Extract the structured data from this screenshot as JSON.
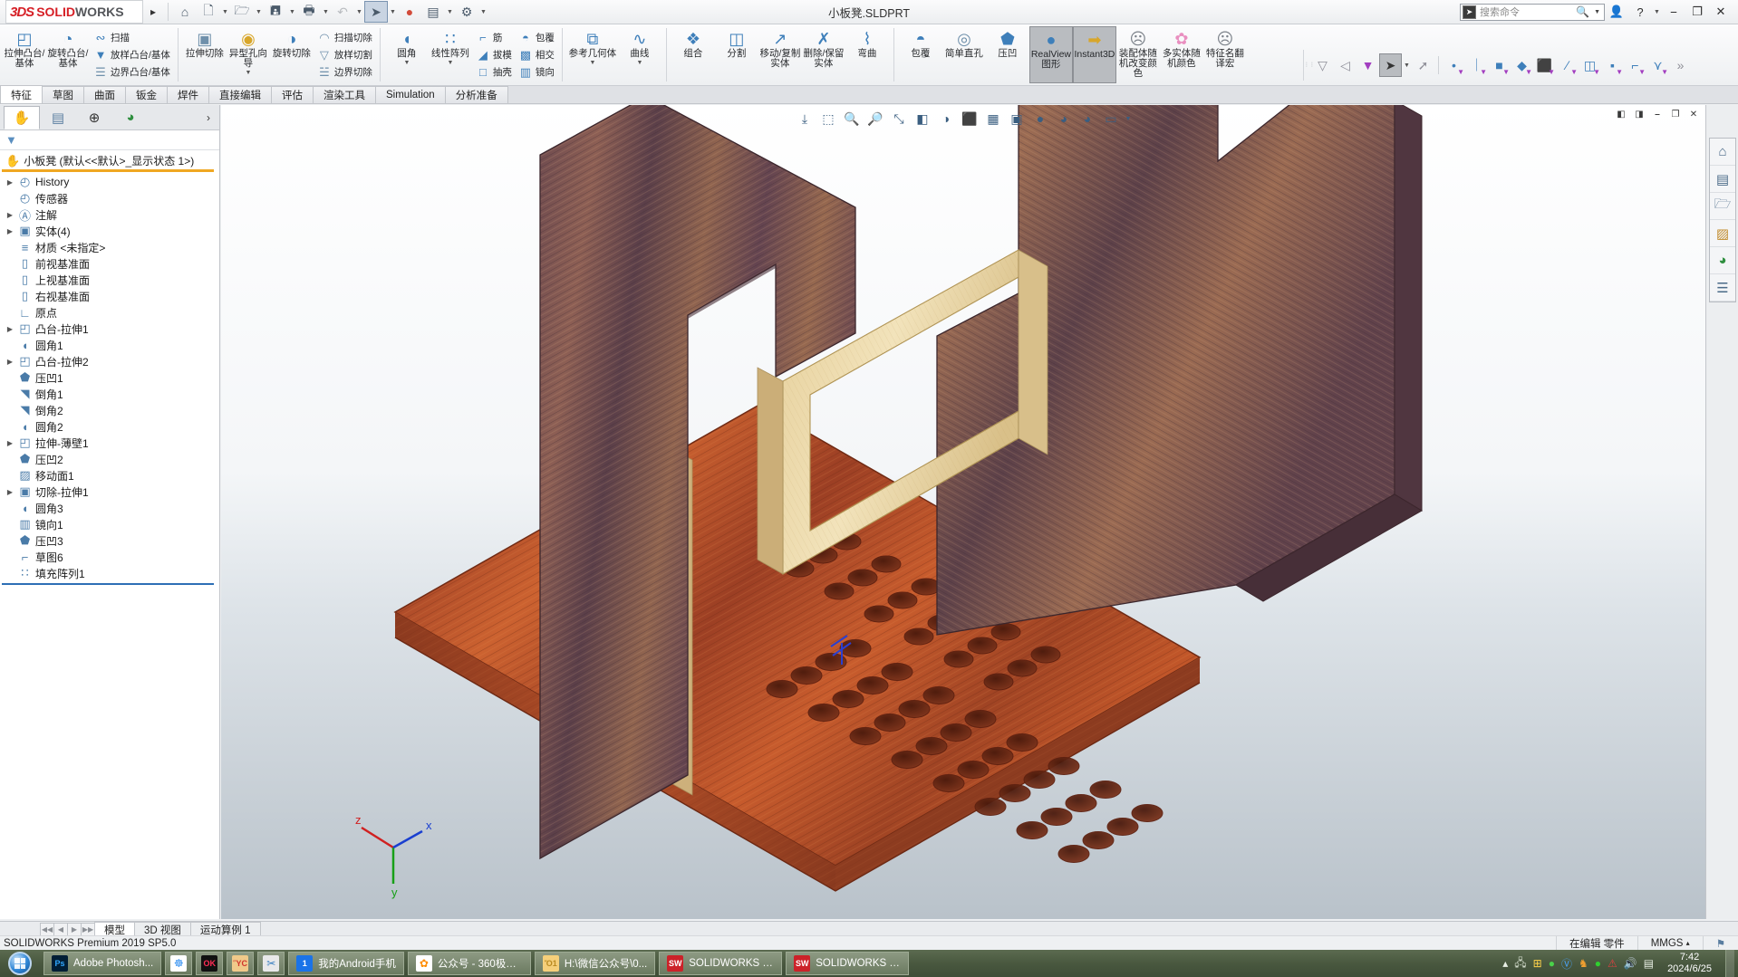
{
  "titlebar": {
    "logo_3ds": "3DS",
    "logo_solid": "SOLID",
    "logo_works": "WORKS",
    "document_title": "小板凳.SLDPRT",
    "quick_access": [
      {
        "name": "home-icon",
        "glyph": "⌂"
      },
      {
        "name": "new-doc-icon",
        "glyph": "὜B"
      },
      {
        "name": "open-icon",
        "glyph": "὜1"
      },
      {
        "name": "save-icon",
        "glyph": "ὋE"
      },
      {
        "name": "print-icon",
        "glyph": "Ὓ6"
      },
      {
        "name": "undo-icon",
        "glyph": "↶"
      },
      {
        "name": "select-icon",
        "glyph": "➤"
      },
      {
        "name": "rebuild-icon",
        "glyph": "⚠"
      },
      {
        "name": "display-icon",
        "glyph": "▤"
      },
      {
        "name": "options-icon",
        "glyph": "⚙"
      }
    ],
    "search_placeholder": "搜索命令",
    "window_buttons": [
      "—",
      "❐",
      "✕"
    ]
  },
  "ribbon": {
    "groups": [
      {
        "name": "boss-base-group",
        "big": [
          {
            "label": "拉伸凸台/基体",
            "icon": "extrude-boss-icon",
            "glyph": "◰",
            "color": "ic-blue",
            "caret": false
          },
          {
            "label": "旋转凸台/基体",
            "icon": "revolve-boss-icon",
            "glyph": "◔",
            "color": "ic-blue",
            "caret": false
          }
        ],
        "small": [
          {
            "label": "扫描",
            "icon": "sweep-icon",
            "glyph": "∴",
            "color": "ic-blue"
          },
          {
            "label": "放样凸台/基体",
            "icon": "loft-icon",
            "glyph": "▼",
            "color": "ic-blue"
          },
          {
            "label": "边界凸台/基体",
            "icon": "boundary-boss-icon",
            "glyph": "❐",
            "color": "ic-steel"
          }
        ]
      },
      {
        "name": "cut-group",
        "big": [
          {
            "label": "拉伸切除",
            "icon": "extrude-cut-icon",
            "glyph": "▣",
            "color": "ic-steel",
            "caret": false
          },
          {
            "label": "异型孔向导",
            "icon": "hole-wizard-icon",
            "glyph": "◉",
            "color": "ic-gold",
            "caret": true
          },
          {
            "label": "旋转切除",
            "icon": "revolve-cut-icon",
            "glyph": "◑",
            "color": "ic-blue",
            "caret": false
          }
        ],
        "small": [
          {
            "label": "扫描切除",
            "icon": "sweep-cut-icon",
            "glyph": "◠",
            "color": "ic-steel"
          },
          {
            "label": "放样切割",
            "icon": "loft-cut-icon",
            "glyph": "▽",
            "color": "ic-steel"
          },
          {
            "label": "边界切除",
            "icon": "boundary-cut-icon",
            "glyph": "❑",
            "color": "ic-steel"
          }
        ]
      },
      {
        "name": "feature-group",
        "big": [
          {
            "label": "圆角",
            "icon": "fillet-icon",
            "glyph": "◖",
            "color": "ic-blue",
            "caret": true
          },
          {
            "label": "线性阵列",
            "icon": "linear-pattern-icon",
            "glyph": "∷",
            "color": "ic-blue",
            "caret": true
          }
        ],
        "small": [
          {
            "label": "筋",
            "icon": "rib-icon",
            "glyph": "⌐",
            "color": "ic-blue"
          },
          {
            "label": "拔模",
            "icon": "draft-icon",
            "glyph": "◢",
            "color": "ic-blue"
          },
          {
            "label": "抽壳",
            "icon": "shell-icon",
            "glyph": "□",
            "color": "ic-blue"
          }
        ],
        "small2": [
          {
            "label": "包覆",
            "icon": "wrap-icon",
            "glyph": "◓",
            "color": "ic-blue"
          },
          {
            "label": "相交",
            "icon": "intersect-icon",
            "glyph": "▩",
            "color": "ic-blue"
          },
          {
            "label": "镜向",
            "icon": "mirror-icon",
            "glyph": "▥",
            "color": "ic-blue"
          }
        ]
      },
      {
        "name": "reference-group",
        "big": [
          {
            "label": "参考几何体",
            "icon": "reference-geometry-icon",
            "glyph": "⧉",
            "color": "ic-blue",
            "caret": true
          },
          {
            "label": "曲线",
            "icon": "curves-icon",
            "glyph": "∿",
            "color": "ic-blue",
            "caret": true
          }
        ],
        "small": []
      },
      {
        "name": "bodies-group",
        "big": [
          {
            "label": "组合",
            "icon": "combine-icon",
            "glyph": "❖",
            "color": "ic-blue",
            "caret": false
          },
          {
            "label": "分割",
            "icon": "split-icon",
            "glyph": "◫",
            "color": "ic-blue",
            "caret": false
          },
          {
            "label": "移动/复制实体",
            "icon": "move-copy-body-icon",
            "glyph": "↗",
            "color": "ic-blue",
            "caret": false
          },
          {
            "label": "删除/保留实体",
            "icon": "delete-keep-body-icon",
            "glyph": "✗",
            "color": "ic-blue",
            "caret": false
          },
          {
            "label": "弯曲",
            "icon": "flex-icon",
            "glyph": "⌇",
            "color": "ic-blue",
            "caret": false
          }
        ],
        "small": []
      },
      {
        "name": "misc-group",
        "big": [
          {
            "label": "包覆",
            "icon": "wrap2-icon",
            "glyph": "◓",
            "color": "ic-blue",
            "caret": false
          },
          {
            "label": "简单直孔",
            "icon": "simple-hole-icon",
            "glyph": "◎",
            "color": "ic-steel",
            "caret": false
          },
          {
            "label": "压凹",
            "icon": "indent-icon",
            "glyph": "⬟",
            "color": "ic-blue",
            "caret": false
          },
          {
            "label": "RealView 图形",
            "icon": "realview-icon",
            "glyph": "●",
            "color": "ic-blue",
            "caret": false,
            "active": true
          },
          {
            "label": "Instant3D",
            "icon": "instant3d-icon",
            "glyph": "➡",
            "color": "ic-gold",
            "caret": false,
            "active": true
          },
          {
            "label": "装配体随机改变颜色",
            "icon": "assembly-random-color-icon",
            "glyph": "⚹",
            "color": "ic-gray",
            "caret": false
          },
          {
            "label": "多实体随机颜色",
            "icon": "multibody-random-color-icon",
            "glyph": "✿",
            "color": "ic-pink",
            "caret": false
          },
          {
            "label": "特征名翻译宏",
            "icon": "feature-name-macro-icon",
            "glyph": "⚹",
            "color": "ic-gray",
            "caret": false
          }
        ],
        "small": []
      }
    ],
    "subbar": {
      "icons": [
        {
          "name": "filter-faces-icon",
          "glyph": "▽",
          "style": ""
        },
        {
          "name": "filter-edges-icon",
          "glyph": "◁",
          "style": ""
        },
        {
          "name": "filter-active-icon",
          "glyph": "▼",
          "style": "purple"
        },
        {
          "name": "select-arrow-icon",
          "glyph": "➤",
          "style": "sel"
        },
        {
          "name": "select-caret-icon",
          "glyph": "▾",
          "style": "caret"
        },
        {
          "name": "select-other-icon",
          "glyph": "➚",
          "style": ""
        },
        {
          "name": "sketch-point-icon",
          "glyph": "•",
          "style": "blue"
        },
        {
          "name": "sketch-line-icon",
          "glyph": "｜",
          "style": "blue"
        },
        {
          "name": "sketch-rectangle-icon",
          "glyph": "■",
          "style": "blue"
        },
        {
          "name": "sketch-slot-icon",
          "glyph": "◆",
          "style": "blue"
        },
        {
          "name": "sketch-3d-icon",
          "glyph": "⬛",
          "style": "blue"
        },
        {
          "name": "sketch-spline-icon",
          "glyph": "∕",
          "style": "blue"
        },
        {
          "name": "sketch-plane-icon",
          "glyph": "◫",
          "style": "blue"
        },
        {
          "name": "sketch-dim-icon",
          "glyph": "▪",
          "style": "blue"
        },
        {
          "name": "sketch-fillet-icon",
          "glyph": "⌐",
          "style": "blue"
        },
        {
          "name": "sketch-trim-icon",
          "glyph": "⋎",
          "style": "blue"
        },
        {
          "name": "overflow-chevron-icon",
          "glyph": "»",
          "style": ""
        }
      ]
    }
  },
  "command_tabs": [
    {
      "label": "特征",
      "active": true
    },
    {
      "label": "草图",
      "active": false
    },
    {
      "label": "曲面",
      "active": false
    },
    {
      "label": "钣金",
      "active": false
    },
    {
      "label": "焊件",
      "active": false
    },
    {
      "label": "直接编辑",
      "active": false
    },
    {
      "label": "评估",
      "active": false
    },
    {
      "label": "渲染工具",
      "active": false
    },
    {
      "label": "Simulation",
      "active": false
    },
    {
      "label": "分析准备",
      "active": false
    }
  ],
  "feature_manager": {
    "tabs": [
      {
        "name": "feature-tree-tab",
        "glyph": "✋",
        "color": "#e8b53a",
        "active": true
      },
      {
        "name": "property-manager-tab",
        "glyph": "▤",
        "color": "#5a7ea0",
        "active": false
      },
      {
        "name": "configuration-manager-tab",
        "glyph": "⊕",
        "color": "#3a3a3a",
        "active": false
      },
      {
        "name": "display-manager-tab",
        "glyph": "◕",
        "color": "#3a8a3a",
        "active": false
      }
    ],
    "expand_glyph": "›",
    "filter_placeholder": "",
    "root": "小板凳  (默认<<默认>_显示状态 1>)",
    "nodes": [
      {
        "label": "History",
        "glyph": "◴",
        "expandable": true
      },
      {
        "label": "传感器",
        "glyph": "◴",
        "expandable": false
      },
      {
        "label": "注解",
        "glyph": "Ⓐ",
        "expandable": true
      },
      {
        "label": "实体(4)",
        "glyph": "▣",
        "expandable": true
      },
      {
        "label": "材质 <未指定>",
        "glyph": "≡",
        "expandable": false
      },
      {
        "label": "前视基准面",
        "glyph": "▯",
        "expandable": false
      },
      {
        "label": "上视基准面",
        "glyph": "▯",
        "expandable": false
      },
      {
        "label": "右视基准面",
        "glyph": "▯",
        "expandable": false
      },
      {
        "label": "原点",
        "glyph": "∟",
        "expandable": false
      },
      {
        "label": "凸台-拉伸1",
        "glyph": "◰",
        "expandable": true
      },
      {
        "label": "圆角1",
        "glyph": "◖",
        "expandable": false
      },
      {
        "label": "凸台-拉伸2",
        "glyph": "◰",
        "expandable": true
      },
      {
        "label": "压凹1",
        "glyph": "⬟",
        "expandable": false
      },
      {
        "label": "倒角1",
        "glyph": "◥",
        "expandable": false
      },
      {
        "label": "倒角2",
        "glyph": "◥",
        "expandable": false
      },
      {
        "label": "圆角2",
        "glyph": "◖",
        "expandable": false
      },
      {
        "label": "拉伸-薄壁1",
        "glyph": "◰",
        "expandable": true
      },
      {
        "label": "压凹2",
        "glyph": "⬟",
        "expandable": false
      },
      {
        "label": "移动面1",
        "glyph": "▨",
        "expandable": false
      },
      {
        "label": "切除-拉伸1",
        "glyph": "▣",
        "expandable": true
      },
      {
        "label": "圆角3",
        "glyph": "◖",
        "expandable": false
      },
      {
        "label": "镜向1",
        "glyph": "▥",
        "expandable": false
      },
      {
        "label": "压凹3",
        "glyph": "⬟",
        "expandable": false
      },
      {
        "label": "草图6",
        "glyph": "⌐",
        "expandable": false
      },
      {
        "label": "填充阵列1",
        "glyph": "∷",
        "expandable": false
      }
    ]
  },
  "graphics": {
    "window_buttons": [
      "◧",
      "◨",
      "—",
      "❐",
      "✕"
    ],
    "heads_up": [
      {
        "name": "zoom-to-fit-icon",
        "glyph": "⤓"
      },
      {
        "name": "zoom-to-area-icon",
        "glyph": "⬚"
      },
      {
        "name": "previous-view-icon",
        "glyph": "ὐD"
      },
      {
        "name": "section-view-icon",
        "glyph": "◒"
      },
      {
        "name": "view-orientation-icon",
        "glyph": "⤡"
      },
      {
        "name": "display-style-icon",
        "glyph": "◧"
      },
      {
        "name": "hide-show-icon",
        "glyph": "◑"
      },
      {
        "name": "edit-appearance-icon",
        "glyph": "⬛"
      },
      {
        "name": "apply-scene-icon",
        "glyph": "▦"
      },
      {
        "name": "view-settings-icon",
        "glyph": "▣"
      },
      {
        "name": "shadow-icon",
        "glyph": "●"
      },
      {
        "name": "color-wheel-icon",
        "glyph": "◕"
      },
      {
        "name": "color-wheel2-icon",
        "glyph": "◕"
      },
      {
        "name": "viewport-icon",
        "glyph": "▭"
      }
    ],
    "triad_labels": {
      "x": "x",
      "y": "y",
      "z": "z"
    }
  },
  "task_pane": [
    {
      "name": "sw-resources-icon",
      "glyph": "⌂"
    },
    {
      "name": "design-library-icon",
      "glyph": "▤"
    },
    {
      "name": "file-explorer-icon",
      "glyph": "὜1"
    },
    {
      "name": "view-palette-icon",
      "glyph": "▨"
    },
    {
      "name": "appearances-scenes-icon",
      "glyph": "◕"
    },
    {
      "name": "custom-properties-icon",
      "glyph": "≡"
    }
  ],
  "document_tabs": {
    "nav_arrows": [
      "⏮",
      "◀",
      "▶",
      "⏭"
    ],
    "tabs": [
      {
        "label": "模型",
        "active": true
      },
      {
        "label": "3D 视图",
        "active": false
      },
      {
        "label": "运动算例 1",
        "active": false
      }
    ]
  },
  "status_bar": {
    "left": "SOLIDWORKS Premium 2019 SP5.0",
    "editing": "在编辑 零件",
    "units": "MMGS",
    "units_caret": "▴",
    "tag_icon": "tag-icon"
  },
  "taskbar": {
    "start_label": "start-orb",
    "items": [
      {
        "label": "Adobe Photosh...",
        "icon": "photoshop-icon",
        "glyph": "Ps",
        "bg": "#001e36",
        "fg": "#31a8ff",
        "iconly": false
      },
      {
        "label": "",
        "icon": "baidu-netdisk-icon",
        "glyph": "☸",
        "bg": "#ffffff",
        "fg": "#2b8cf0",
        "iconly": true
      },
      {
        "label": "",
        "icon": "ok-app-icon",
        "glyph": "OK",
        "bg": "#111111",
        "fg": "#ff2d55",
        "iconly": true
      },
      {
        "label": "",
        "icon": "photo-viewer-icon",
        "glyph": "ὛC",
        "bg": "#f0c98a",
        "fg": "#d0342c",
        "iconly": true
      },
      {
        "label": "",
        "icon": "snipping-tool-icon",
        "glyph": "✂",
        "bg": "#e8e8ea",
        "fg": "#3a7fc1",
        "iconly": true
      },
      {
        "label": "我的Android手机",
        "icon": "android-phone-icon",
        "glyph": "὏1",
        "bg": "#1a73e8",
        "fg": "#ffffff",
        "iconly": false
      },
      {
        "label": "公众号 - 360极速...",
        "icon": "browser-360-icon",
        "glyph": "✿",
        "bg": "#ffffff",
        "fg": "#ff8c00",
        "iconly": false
      },
      {
        "label": "H:\\微信公众号\\0...",
        "icon": "folder-icon",
        "glyph": "Ὄ1",
        "bg": "#f5cf7a",
        "fg": "#b98a20",
        "iconly": false
      },
      {
        "label": "SOLIDWORKS P...",
        "icon": "solidworks-icon",
        "glyph": "SW",
        "bg": "#cc2229",
        "fg": "#ffffff",
        "iconly": false
      },
      {
        "label": "SOLIDWORKS P...",
        "icon": "solidworks-icon",
        "glyph": "SW",
        "bg": "#cc2229",
        "fg": "#ffffff",
        "iconly": false
      }
    ],
    "tray": [
      {
        "name": "hidden-icons-icon",
        "glyph": "▴"
      },
      {
        "name": "network-icon",
        "glyph": "὚7"
      },
      {
        "name": "windows-store-icon",
        "glyph": "⊞"
      },
      {
        "name": "wechat-icon",
        "glyph": "●"
      },
      {
        "name": "kingsoft-icon",
        "glyph": "Ⓚ"
      },
      {
        "name": "qq-icon",
        "glyph": "♞"
      },
      {
        "name": "green-circle-icon",
        "glyph": "●"
      },
      {
        "name": "alert-icon",
        "glyph": "⚠"
      },
      {
        "name": "volume-icon",
        "glyph": "ὐA"
      },
      {
        "name": "action-center-icon",
        "glyph": "▤"
      }
    ],
    "clock_time": "7:42",
    "clock_date": "2024/6/25"
  }
}
